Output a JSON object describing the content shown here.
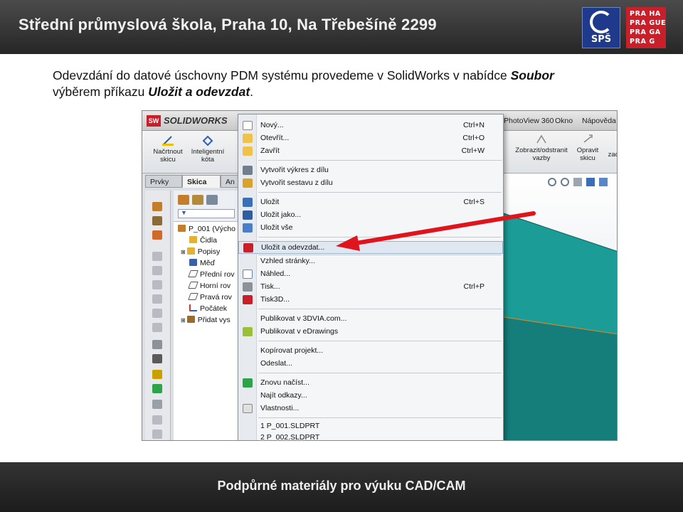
{
  "header": {
    "title": "Střední průmyslová škola, Praha 10, Na Třebešíně 2299",
    "logo_sps_text": "SPŠ",
    "logo_prague_lines": [
      "PRA HA",
      "PRA GUE",
      "PRA GA",
      "PRA G"
    ]
  },
  "body": {
    "line1_prefix": "Odevzdání do datové úschovny PDM systému provedeme v SolidWorks v nabídce ",
    "line1_bold": "Soubor",
    "line2_prefix": "výběrem příkazu ",
    "line2_bold": "Uložit a odevzdat",
    "line2_suffix": "."
  },
  "footer": {
    "text": "Podpůrné materiály pro výuku CAD/CAM"
  },
  "app": {
    "logo_text": "SOLIDWORKS",
    "logo_badge": "SW",
    "menubar_right": [
      "PhotoView 360",
      "Okno",
      "Nápověda"
    ],
    "ribbon": {
      "sketch_button": "Načrtnout skicu",
      "smart_dim_button": "Inteligentní kóta",
      "show_hide_relations": "Zobrazit/odstranit vazby",
      "repair_sketch": "Opravit skicu",
      "cut_label": "zac"
    },
    "tabs": [
      "Prvky",
      "Skica",
      "An"
    ],
    "tree": {
      "root": "P_001  (Výcho",
      "items": [
        "Čidla",
        "Popisy",
        "Měď",
        "Přední rov",
        "Horní rov",
        "Pravá rov",
        "Počátek",
        "Přidat vys"
      ]
    }
  },
  "menu": {
    "items": [
      {
        "label": "Nový...",
        "shortcut": "Ctrl+N"
      },
      {
        "label": "Otevřít...",
        "shortcut": "Ctrl+O"
      },
      {
        "label": "Zavřít",
        "shortcut": "Ctrl+W"
      },
      {
        "label": "Vytvořit výkres z dílu",
        "shortcut": ""
      },
      {
        "label": "Vytvořit sestavu z dílu",
        "shortcut": ""
      },
      {
        "label": "Uložit",
        "shortcut": "Ctrl+S"
      },
      {
        "label": "Uložit jako...",
        "shortcut": ""
      },
      {
        "label": "Uložit vše",
        "shortcut": ""
      },
      {
        "label": "Uložit a odevzdat...",
        "shortcut": ""
      },
      {
        "label": "Vzhled stránky...",
        "shortcut": ""
      },
      {
        "label": "Náhled...",
        "shortcut": ""
      },
      {
        "label": "Tisk...",
        "shortcut": "Ctrl+P"
      },
      {
        "label": "Tisk3D...",
        "shortcut": ""
      },
      {
        "label": "Publikovat v 3DVIA.com...",
        "shortcut": ""
      },
      {
        "label": "Publikovat v eDrawings",
        "shortcut": ""
      },
      {
        "label": "Kopírovat projekt...",
        "shortcut": ""
      },
      {
        "label": "Odeslat...",
        "shortcut": ""
      },
      {
        "label": "Znovu načíst...",
        "shortcut": ""
      },
      {
        "label": "Najít odkazy...",
        "shortcut": ""
      },
      {
        "label": "Vlastnosti...",
        "shortcut": ""
      },
      {
        "label": "1 P_001.SLDPRT",
        "shortcut": ""
      },
      {
        "label": "2 P_002.SLDPRT",
        "shortcut": ""
      }
    ],
    "highlighted": "Uložit a odevzdat..."
  },
  "colors": {
    "header_bg": "#333333",
    "arrow_red": "#e0141c",
    "model_teal": "#1b9c96",
    "sps_blue": "#1f3a8a",
    "prague_red": "#c8202a"
  }
}
